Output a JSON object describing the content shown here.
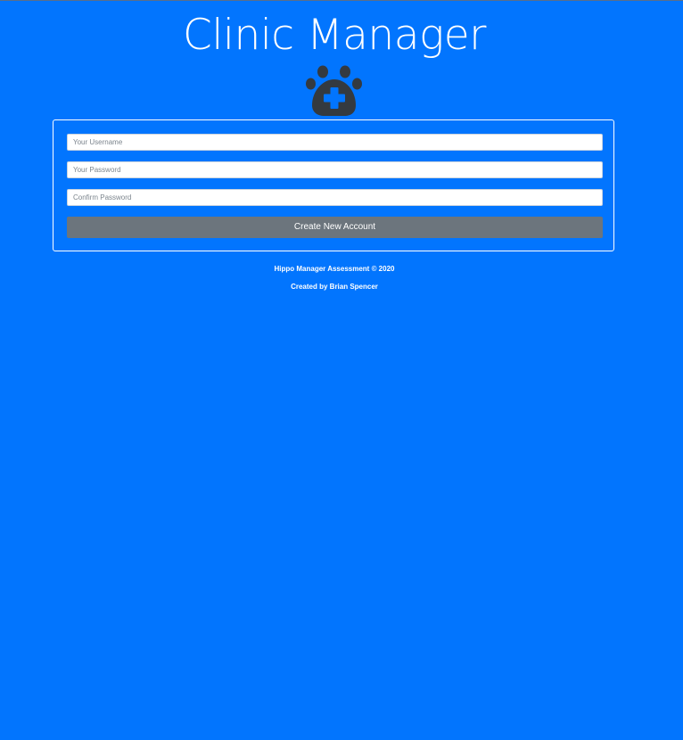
{
  "app": {
    "title": "Clinic Manager",
    "logo_icon": "paw-medical-cross-icon"
  },
  "form": {
    "username_placeholder": "Your Username",
    "password_placeholder": "Your Password",
    "confirm_placeholder": "Confirm Password",
    "submit_label": "Create New Account"
  },
  "footer": {
    "copyright": "Hippo Manager Assessment © 2020",
    "credit": "Created by Brian Spencer"
  },
  "colors": {
    "background": "#0275fe",
    "button": "#6c757d",
    "logo": "#343a40",
    "cross": "#0275fe"
  }
}
